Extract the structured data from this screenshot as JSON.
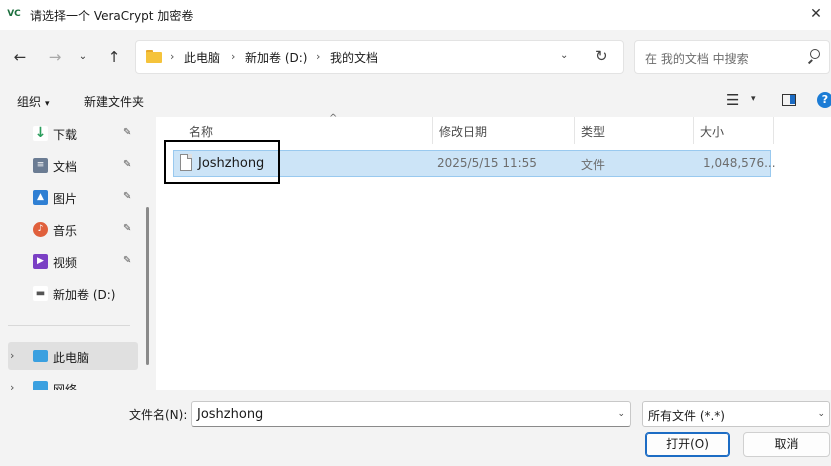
{
  "window": {
    "title": "请选择一个 VeraCrypt 加密卷",
    "app_icon": "VC",
    "close_glyph": "✕"
  },
  "nav": {
    "back_glyph": "←",
    "forward_glyph": "→",
    "recent_glyph": "⌄",
    "up_glyph": "↑"
  },
  "breadcrumb": {
    "items": [
      "此电脑",
      "新加卷 (D:)",
      "我的文档"
    ],
    "separator": "›",
    "dropdown_glyph": "⌄",
    "refresh_glyph": "↻"
  },
  "search": {
    "placeholder": "在 我的文档 中搜索"
  },
  "commands": {
    "organize": "组织",
    "new_folder": "新建文件夹",
    "caret": "▾",
    "view_glyph": "☰",
    "help_glyph": "?"
  },
  "sidebar": {
    "items": [
      {
        "label": "下载",
        "icon": "download-icon",
        "glyph": "↓",
        "color": "#2a9d5c",
        "pinned": true
      },
      {
        "label": "文档",
        "icon": "document-icon",
        "glyph": "≡",
        "color": "#6b7c93",
        "pinned": true
      },
      {
        "label": "图片",
        "icon": "pictures-icon",
        "glyph": "▲",
        "color": "#2f7fd3",
        "pinned": true
      },
      {
        "label": "音乐",
        "icon": "music-icon",
        "glyph": "♪",
        "color": "#e0603c",
        "pinned": true
      },
      {
        "label": "视频",
        "icon": "video-icon",
        "glyph": "▶",
        "color": "#7a3fc4",
        "pinned": true
      },
      {
        "label": "新加卷 (D:)",
        "icon": "drive-icon",
        "glyph": "▬",
        "color": "#555555",
        "pinned": false
      }
    ],
    "pin_glyph": "📌",
    "this_pc": "此电脑",
    "network": "网络",
    "expand_glyph": "›"
  },
  "columns": {
    "name": "名称",
    "modified": "修改日期",
    "type": "类型",
    "size": "大小",
    "sort_glyph": "^"
  },
  "files": [
    {
      "name": "Joshzhong",
      "modified": "2025/5/15 11:55",
      "type": "文件",
      "size": "1,048,576..."
    }
  ],
  "footer": {
    "filename_label": "文件名(N):",
    "filename_value": "Joshzhong",
    "filetype_value": "所有文件 (*.*)",
    "open_button": "打开(O)",
    "cancel_button": "取消",
    "caret": "⌄"
  },
  "colors": {
    "accent": "#1c6cc4",
    "selection": "#cce4f7",
    "highlight_outline": "#000000"
  }
}
